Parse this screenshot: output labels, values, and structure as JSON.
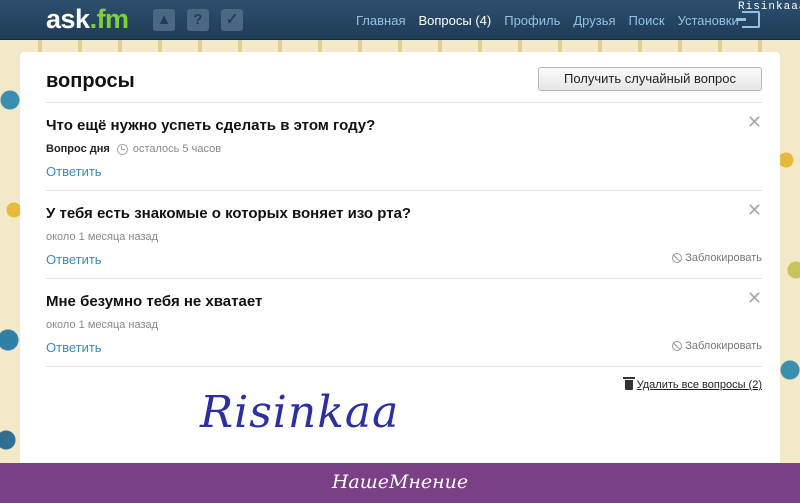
{
  "topbar": {
    "logo_main": "ask",
    "logo_ext": ".fm",
    "icons": [
      "like-icon",
      "question-icon",
      "check-icon"
    ],
    "nav": [
      {
        "label": "Главная"
      },
      {
        "label": "Вопросы (4)"
      },
      {
        "label": "Профиль"
      },
      {
        "label": "Друзья"
      },
      {
        "label": "Поиск"
      },
      {
        "label": "Установки"
      }
    ],
    "watermark": "Risinkaaa"
  },
  "main": {
    "title": "вопросы",
    "random_button": "Получить случайный вопрос",
    "questions": [
      {
        "text": "Что ещё нужно успеть сделать в этом году?",
        "label": "Вопрос дня",
        "time": "осталось 5 часов",
        "answer": "Ответить"
      },
      {
        "text": "У тебя есть знакомые о которых воняет изо рта?",
        "time": "около 1 месяца назад",
        "answer": "Ответить",
        "block": "Заблокировать"
      },
      {
        "text": "Мне безумно тебя не хватает",
        "time": "около 1 месяца назад",
        "answer": "Ответить",
        "block": "Заблокировать"
      }
    ],
    "delete_all": "Удалить все вопросы (2)",
    "signature": "Risinkaa"
  },
  "footer": {
    "brand": "НашеМнение"
  },
  "colors": {
    "topbar": "#1f3c58",
    "link": "#3a8bb5",
    "logo_accent": "#7fcf3a",
    "footer": "#7b3f86"
  }
}
